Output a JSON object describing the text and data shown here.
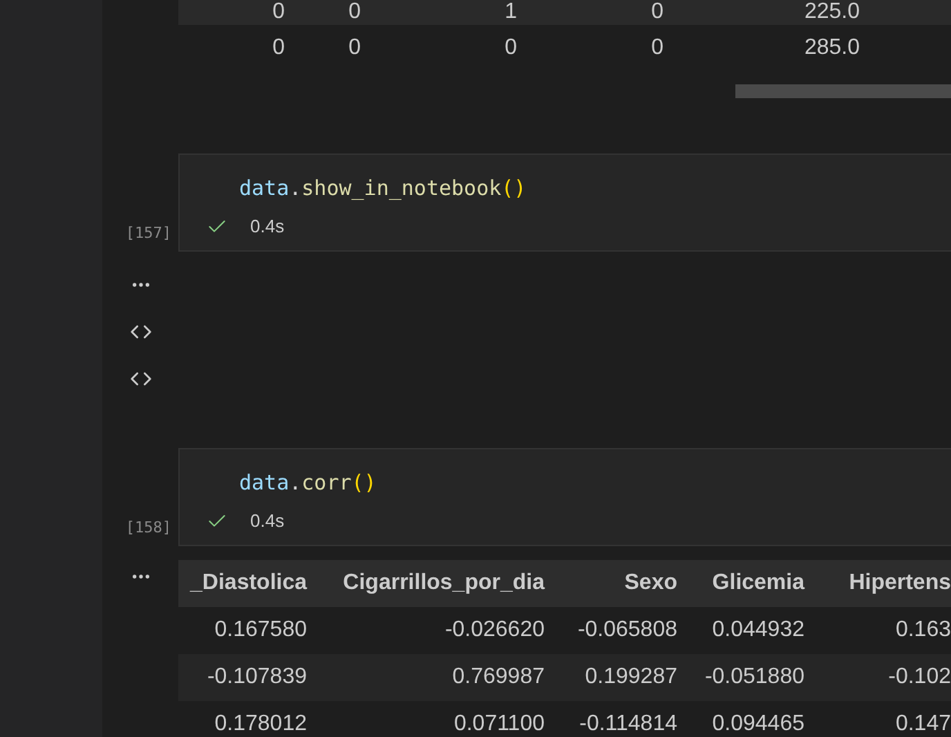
{
  "top_output_table": {
    "rows": [
      {
        "cells": [
          "0",
          "0",
          "1",
          "0",
          "225.0"
        ]
      },
      {
        "cells": [
          "0",
          "0",
          "0",
          "0",
          "285.0"
        ]
      }
    ]
  },
  "cells": [
    {
      "execution_count": "[157]",
      "succeeded": true,
      "duration": "0.4s",
      "code": [
        {
          "kind": "variable",
          "text": "data"
        },
        {
          "kind": "punctuation",
          "text": "."
        },
        {
          "kind": "function",
          "text": "show_in_notebook"
        },
        {
          "kind": "bracket",
          "text": "()"
        }
      ]
    },
    {
      "execution_count": "[158]",
      "succeeded": true,
      "duration": "0.4s",
      "code": [
        {
          "kind": "variable",
          "text": "data"
        },
        {
          "kind": "punctuation",
          "text": "."
        },
        {
          "kind": "function",
          "text": "corr"
        },
        {
          "kind": "bracket",
          "text": "()"
        }
      ]
    }
  ],
  "corr_table": {
    "columns": [
      "_Diastolica",
      "Cigarrillos_por_dia",
      "Sexo",
      "Glicemia",
      "Hipertens"
    ],
    "rows": [
      {
        "cells": [
          "0.167580",
          "-0.026620",
          "-0.065808",
          "0.044932",
          "0.163"
        ]
      },
      {
        "cells": [
          "-0.107839",
          "0.769987",
          "0.199287",
          "-0.051880",
          "-0.102"
        ]
      },
      {
        "cells": [
          "0.178012",
          "0.071100",
          "-0.114814",
          "0.094465",
          "0.147"
        ]
      }
    ]
  }
}
